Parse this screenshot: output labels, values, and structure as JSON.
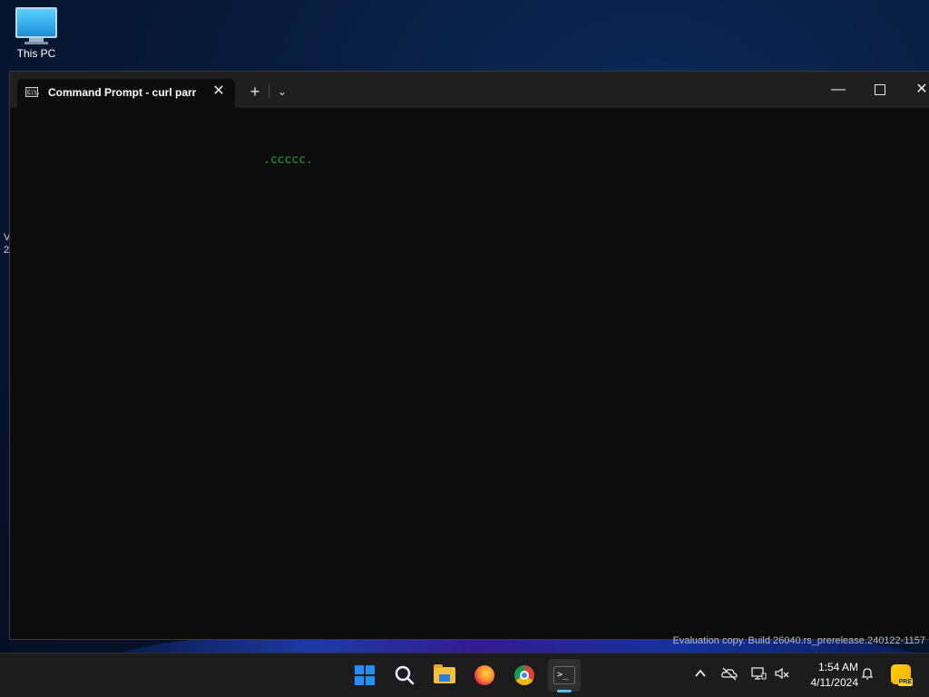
{
  "desktop": {
    "icon_label": "This PC",
    "edge_text_1": "V",
    "edge_text_2": "2",
    "watermark": "Evaluation copy. Build 26040.rs_prerelease.240122-1157"
  },
  "window": {
    "tab_title": "Command Prompt - curl  parr",
    "tab_icon_text": "C:\\.",
    "new_tab_glyph": "+",
    "dropdown_glyph": "⌄",
    "close_tab_glyph": "✕",
    "min_glyph": "—",
    "close_glyph": "✕"
  },
  "terminal": {
    "line": ".ccccc.",
    "text_color": "#16a80f",
    "background": "#0c0c0c"
  },
  "taskbar": {
    "items": [
      "start-icon",
      "search-icon",
      "file-explorer-icon",
      "firefox-icon",
      "chrome-icon",
      "terminal-icon"
    ],
    "active_item": "terminal-icon",
    "terminal_icon_text": ">_",
    "tray": {
      "chevron": "^",
      "time": "1:54 AM",
      "date": "4/11/2024",
      "badge": "PRE"
    },
    "accent": "#4cc2ff"
  }
}
